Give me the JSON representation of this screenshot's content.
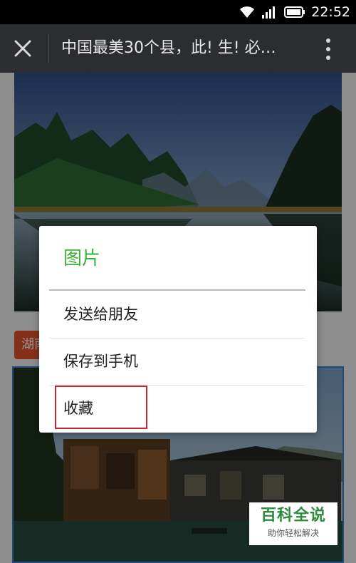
{
  "status_bar": {
    "time": "22:52",
    "icons": [
      "wifi-icon",
      "signal-icon",
      "battery-icon"
    ]
  },
  "title_bar": {
    "title": "中国最美30个县，此! 生! 必…",
    "close_icon": "close-icon",
    "more_icon": "more-vertical-icon"
  },
  "content": {
    "tag_label": "湖南"
  },
  "dialog": {
    "title": "图片",
    "items": [
      {
        "label": "发送给朋友"
      },
      {
        "label": "保存到手机"
      },
      {
        "label": "收藏"
      }
    ]
  },
  "watermark": {
    "main": "百科全说",
    "sub": "助你轻松解决"
  },
  "colors": {
    "title_bar_bg": "#2b2d31",
    "dialog_title": "#3bb23b",
    "highlight_border": "#c8242b",
    "tag_bg": "#e5552e",
    "watermark_green": "#2c8b3c"
  }
}
